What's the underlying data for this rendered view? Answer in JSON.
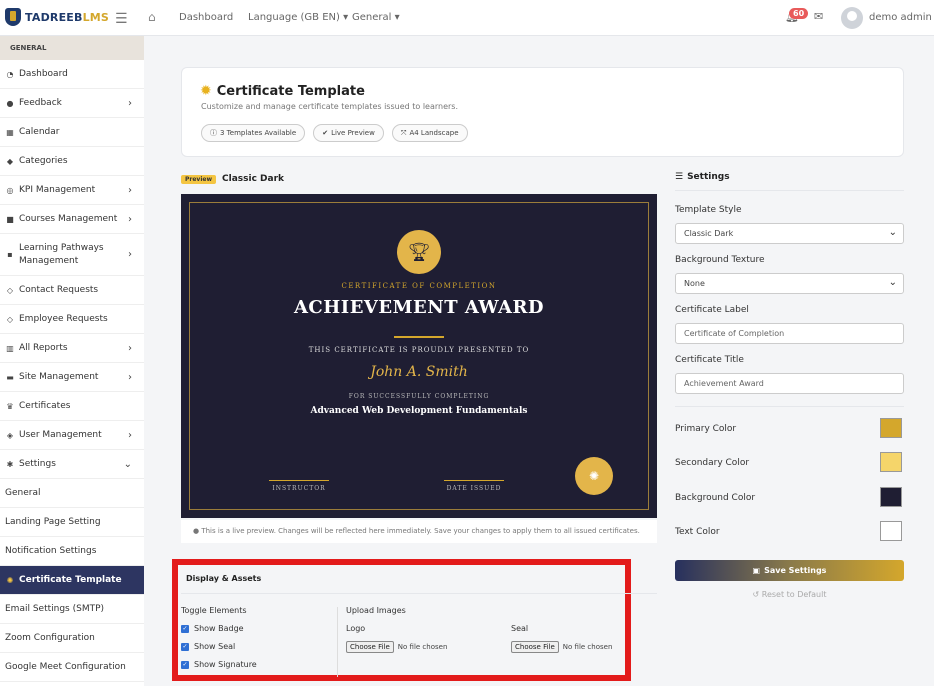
{
  "topbar": {
    "logo_main": "TADREEB",
    "logo_accent": "LMS",
    "nav": [
      "Dashboard",
      "Language (GB EN)",
      "General"
    ],
    "notif_count": "60",
    "user": "demo admin"
  },
  "sidebar": {
    "header": "GENERAL",
    "items": [
      {
        "label": "Dashboard",
        "icon": "dashboard-icon"
      },
      {
        "label": "Feedback",
        "icon": "chat-icon"
      },
      {
        "label": "Calendar",
        "icon": "calendar-icon"
      },
      {
        "label": "Categories",
        "icon": "tag-icon"
      },
      {
        "label": "KPI Management",
        "icon": "target-icon"
      },
      {
        "label": "Courses Management",
        "icon": "courses-icon"
      },
      {
        "label": "Learning Pathways Management",
        "icon": "pathway-icon"
      },
      {
        "label": "Contact Requests",
        "icon": "contact-icon"
      },
      {
        "label": "Employee Requests",
        "icon": "employee-icon"
      },
      {
        "label": "All Reports",
        "icon": "chart-icon"
      },
      {
        "label": "Site Management",
        "icon": "site-icon"
      },
      {
        "label": "Certificates",
        "icon": "trophy-icon"
      },
      {
        "label": "User Management",
        "icon": "shield-icon"
      },
      {
        "label": "Settings",
        "icon": "gear-icon"
      },
      {
        "label": "General"
      },
      {
        "label": "Landing Page Setting"
      },
      {
        "label": "Notification Settings"
      },
      {
        "label": "Certificate Template"
      },
      {
        "label": "Email Settings (SMTP)"
      },
      {
        "label": "Zoom Configuration"
      },
      {
        "label": "Google Meet Configuration"
      }
    ]
  },
  "header": {
    "title": "Certificate Template",
    "subtitle": "Customize and manage certificate templates issued to learners.",
    "pills": [
      "3 Templates Available",
      "Live Preview",
      "A4 Landscape"
    ]
  },
  "preview": {
    "tag": "Preview",
    "name": "Classic Dark",
    "cert_label": "CERTIFICATE OF COMPLETION",
    "cert_title": "ACHIEVEMENT AWARD",
    "presented": "THIS CERTIFICATE IS PROUDLY PRESENTED TO",
    "recipient": "John A. Smith",
    "for_text": "FOR SUCCESSFULLY COMPLETING",
    "course": "Advanced Web Development Fundamentals",
    "sig_left": "INSTRUCTOR",
    "sig_right": "DATE ISSUED",
    "note": "This is a live preview. Changes will be reflected here immediately. Save your changes to apply them to all issued certificates."
  },
  "display": {
    "title": "Display & Assets",
    "toggle_title": "Toggle Elements",
    "toggles": [
      "Show Badge",
      "Show Seal",
      "Show Signature"
    ],
    "upload_title": "Upload Images",
    "logo_label": "Logo",
    "seal_label": "Seal",
    "choose": "Choose File",
    "no_file": "No file chosen"
  },
  "settings": {
    "title": "Settings",
    "style_label": "Template Style",
    "style_value": "Classic Dark",
    "texture_label": "Background Texture",
    "texture_value": "None",
    "cert_label_label": "Certificate Label",
    "cert_label_value": "Certificate of Completion",
    "cert_title_label": "Certificate Title",
    "cert_title_value": "Achievement Award",
    "colors": [
      {
        "label": "Primary Color",
        "value": "#d4a72c"
      },
      {
        "label": "Secondary Color",
        "value": "#f5d56a"
      },
      {
        "label": "Background Color",
        "value": "#1f1e33"
      },
      {
        "label": "Text Color",
        "value": "#ffffff"
      }
    ],
    "save": "Save Settings",
    "reset": "Reset to Default"
  }
}
